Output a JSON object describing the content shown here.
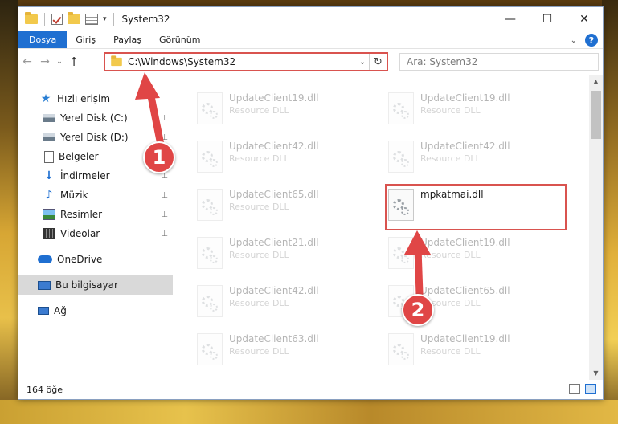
{
  "window": {
    "title": "System32",
    "minimize_glyph": "—",
    "maximize_glyph": "☐",
    "close_glyph": "✕"
  },
  "ribbon": {
    "tabs": [
      "Dosya",
      "Giriş",
      "Paylaş",
      "Görünüm"
    ],
    "help_glyph": "?"
  },
  "nav": {
    "back_glyph": "←",
    "forward_glyph": "→",
    "recent_glyph": "⌄",
    "up_glyph": "↑",
    "address": "C:\\Windows\\System32",
    "address_dropdown_glyph": "⌄",
    "refresh_glyph": "↻",
    "search_placeholder": "Ara: System32"
  },
  "sidebar": {
    "items": [
      {
        "label": "Hızlı erişim",
        "icon": "star-icon"
      },
      {
        "label": "Yerel Disk (C:)",
        "icon": "drive-icon",
        "pinned": true
      },
      {
        "label": "Yerel Disk (D:)",
        "icon": "drive-icon",
        "pinned": true
      },
      {
        "label": "Belgeler",
        "icon": "documents-icon",
        "pinned": true
      },
      {
        "label": "İndirmeler",
        "icon": "download-icon",
        "pinned": true
      },
      {
        "label": "Müzik",
        "icon": "music-icon",
        "pinned": true
      },
      {
        "label": "Resimler",
        "icon": "pictures-icon",
        "pinned": true
      },
      {
        "label": "Videolar",
        "icon": "videos-icon",
        "pinned": true
      },
      {
        "label": "OneDrive",
        "icon": "cloud-icon"
      },
      {
        "label": "Bu bilgisayar",
        "icon": "computer-icon",
        "selected": true
      },
      {
        "label": "Ağ",
        "icon": "network-icon"
      }
    ],
    "pin_glyph": "📌"
  },
  "files": {
    "left_column": [
      {
        "name": "UpdateClient19.dll",
        "type": "Resource DLL"
      },
      {
        "name": "UpdateClient42.dll",
        "type": "Resource DLL"
      },
      {
        "name": "UpdateClient65.dll",
        "type": "Resource DLL"
      },
      {
        "name": "UpdateClient21.dll",
        "type": "Resource DLL"
      },
      {
        "name": "UpdateClient42.dll",
        "type": "Resource DLL"
      },
      {
        "name": "UpdateClient63.dll",
        "type": "Resource DLL"
      }
    ],
    "right_column": [
      {
        "name": "UpdateClient19.dll",
        "type": "Resource DLL"
      },
      {
        "name": "UpdateClient42.dll",
        "type": "Resource DLL"
      },
      {
        "name": "mpkatmai.dll",
        "type": ""
      },
      {
        "name": "UpdateClient19.dll",
        "type": "Resource DLL"
      },
      {
        "name": "UpdateClient65.dll",
        "type": "Resource DLL"
      },
      {
        "name": "UpdateClient19.dll",
        "type": "Resource DLL"
      }
    ],
    "highlighted_name": "mpkatmai.dll"
  },
  "status": {
    "count": "164 öğe"
  },
  "annotations": {
    "callout_1": "1",
    "callout_2": "2",
    "color": "#e04646"
  }
}
